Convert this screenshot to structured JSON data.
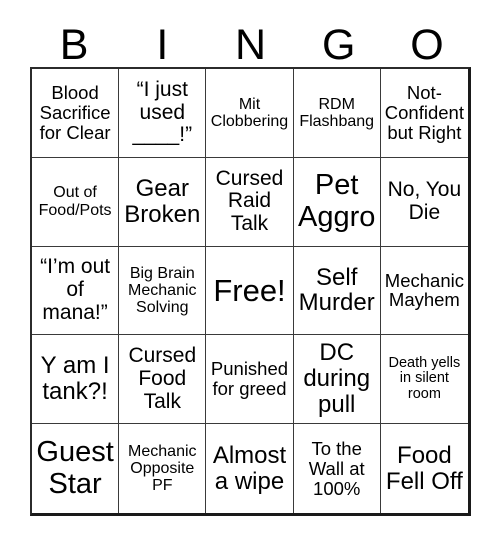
{
  "header": {
    "letters": [
      "B",
      "I",
      "N",
      "G",
      "O"
    ]
  },
  "grid": {
    "rows": 5,
    "columns": 5,
    "cells": [
      {
        "text": "Blood Sacrifice for Clear",
        "size": "sz-md"
      },
      {
        "text": "“I just used ____!”",
        "size": "sz-lg"
      },
      {
        "text": "Mit Clobbering",
        "size": "sz-sm"
      },
      {
        "text": "RDM Flashbang",
        "size": "sz-sm"
      },
      {
        "text": "Not-Confident but Right",
        "size": "sz-md"
      },
      {
        "text": "Out of Food/Pots",
        "size": "sz-sm"
      },
      {
        "text": "Gear Broken",
        "size": "sz-xl"
      },
      {
        "text": "Cursed Raid Talk",
        "size": "sz-lg"
      },
      {
        "text": "Pet Aggro",
        "size": "sz-xxl"
      },
      {
        "text": "No, You Die",
        "size": "sz-lg"
      },
      {
        "text": "“I’m out of mana!”",
        "size": "sz-lg"
      },
      {
        "text": "Big Brain Mechanic Solving",
        "size": "sz-sm"
      },
      {
        "text": "Free!",
        "size": "sz-free"
      },
      {
        "text": "Self Murder",
        "size": "sz-xl"
      },
      {
        "text": "Mechanic Mayhem",
        "size": "sz-md"
      },
      {
        "text": "Y am I tank?!",
        "size": "sz-xl"
      },
      {
        "text": "Cursed Food Talk",
        "size": "sz-lg"
      },
      {
        "text": "Punished for greed",
        "size": "sz-md"
      },
      {
        "text": "DC during pull",
        "size": "sz-xl"
      },
      {
        "text": "Death yells in silent room",
        "size": "sz-xs"
      },
      {
        "text": "Guest Star",
        "size": "sz-xxl"
      },
      {
        "text": "Mechanic Opposite PF",
        "size": "sz-sm"
      },
      {
        "text": "Almost a wipe",
        "size": "sz-xl"
      },
      {
        "text": "To the Wall at 100%",
        "size": "sz-md"
      },
      {
        "text": "Food Fell Off",
        "size": "sz-xl"
      }
    ]
  },
  "colors": {
    "background": "#ffffff",
    "text": "#000000",
    "grid_line": "#3a3a3a",
    "grid_border": "#1a1a1a"
  }
}
